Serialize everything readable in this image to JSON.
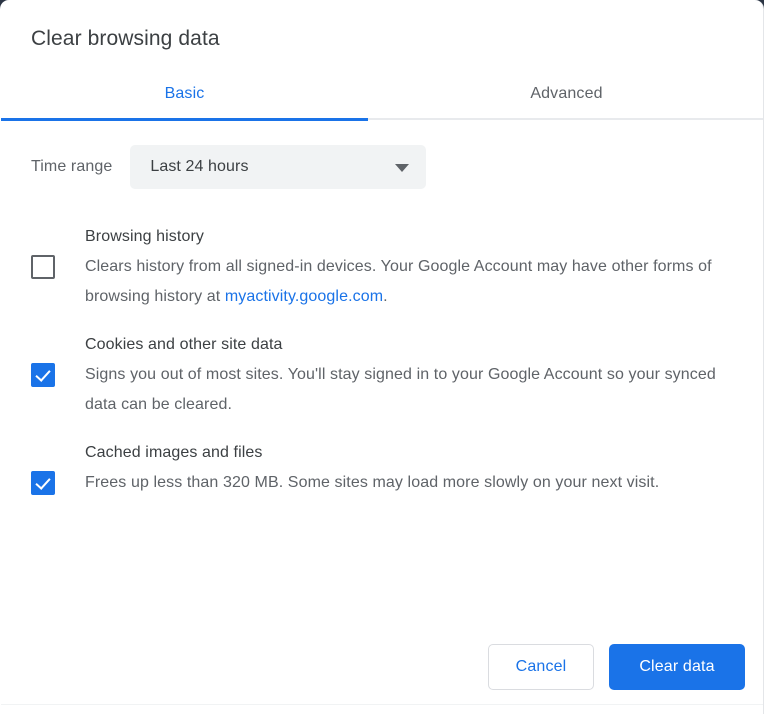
{
  "dialog": {
    "title": "Clear browsing data"
  },
  "tabs": [
    {
      "label": "Basic",
      "selected": true
    },
    {
      "label": "Advanced",
      "selected": false
    }
  ],
  "time_range": {
    "label": "Time range",
    "value": "Last 24 hours",
    "icon": "chevron-down-icon"
  },
  "options": [
    {
      "title": "Browsing history",
      "desc_before_link": "Clears history from all signed-in devices. Your Google Account may have other forms of browsing history at ",
      "link_text": "myactivity.google.com",
      "desc_after_link": ".",
      "checked": false
    },
    {
      "title": "Cookies and other site data",
      "desc": "Signs you out of most sites. You'll stay signed in to your Google Account so your synced data can be cleared.",
      "checked": true
    },
    {
      "title": "Cached images and files",
      "desc": "Frees up less than 320 MB. Some sites may load more slowly on your next visit.",
      "checked": true
    }
  ],
  "footer": {
    "cancel_label": "Cancel",
    "confirm_label": "Clear data"
  },
  "colors": {
    "accent": "#1a73e8",
    "text_primary": "#3c4043",
    "text_secondary": "#5f6368",
    "field_bg": "#f1f3f4",
    "border": "#dadce0"
  }
}
